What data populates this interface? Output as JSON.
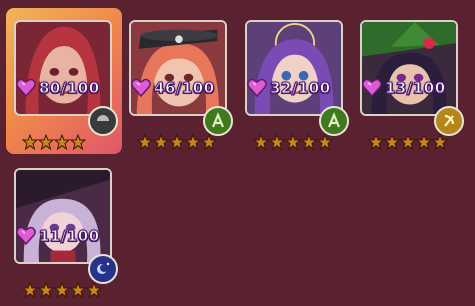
{
  "cards": [
    {
      "affection": "80/100",
      "class_icon": "dark-class-icon",
      "badge_color": "#3a3a3a",
      "stars": 4,
      "selected": true
    },
    {
      "affection": "46/100",
      "class_icon": "nature-class-icon",
      "badge_color": "#3f7a1e",
      "stars": 5,
      "selected": false
    },
    {
      "affection": "32/100",
      "class_icon": "nature-class-icon",
      "badge_color": "#3f7a1e",
      "stars": 5,
      "selected": false
    },
    {
      "affection": "13/100",
      "class_icon": "gold-class-icon",
      "badge_color": "#b4871c",
      "stars": 5,
      "selected": false
    },
    {
      "affection": "11/100",
      "class_icon": "cosmic-class-icon",
      "badge_color": "#27338a",
      "stars": 5,
      "selected": false
    }
  ],
  "colors": {
    "background": "#5a2230",
    "star_fill": "#c7841f",
    "heart": "#e05ad7"
  }
}
